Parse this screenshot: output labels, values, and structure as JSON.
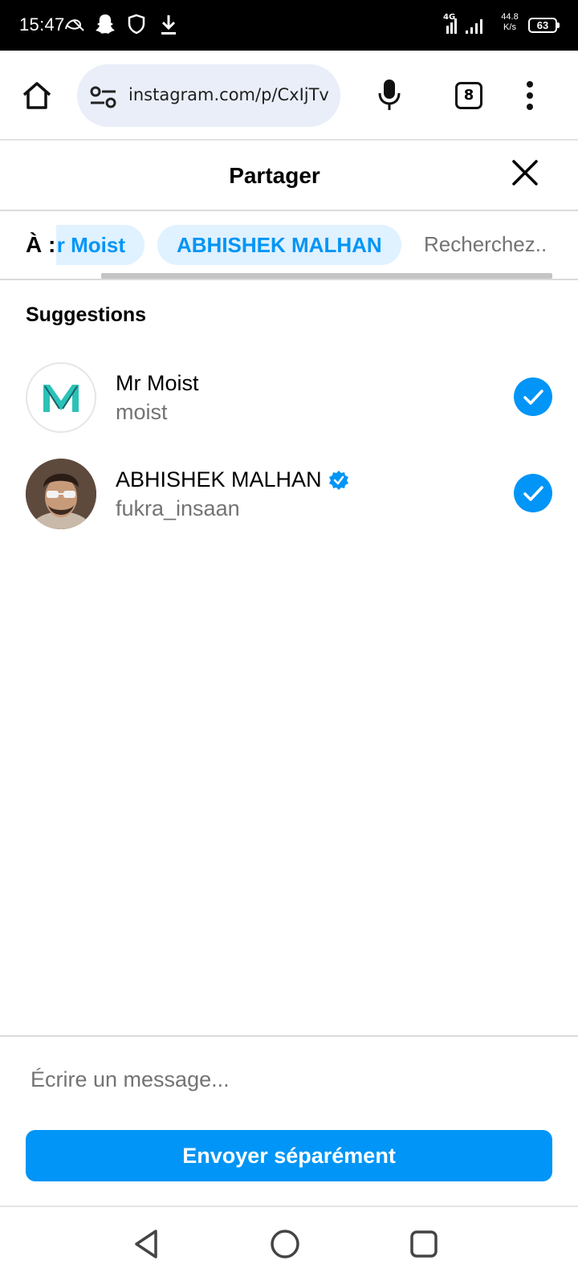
{
  "status_bar": {
    "time": "15:47",
    "icons": [
      "alarm-icon",
      "snapchat-icon",
      "shield-icon",
      "download-icon"
    ],
    "network": "4G",
    "speed_value": "44.8",
    "speed_unit": "K/s",
    "battery": "63"
  },
  "browser": {
    "url": "instagram.com/p/CxIjTv",
    "tab_count": "8"
  },
  "share": {
    "title": "Partager",
    "to_label": "À :",
    "selected_recipients": [
      "r Moist",
      "ABHISHEK MALHAN"
    ],
    "search_placeholder": "Recherchez..",
    "suggestions_heading": "Suggestions",
    "suggestions": [
      {
        "name": "Mr Moist",
        "username": "moist",
        "verified": false,
        "selected": true
      },
      {
        "name": "ABHISHEK MALHAN",
        "username": "fukra_insaan",
        "verified": true,
        "selected": true
      }
    ],
    "message_placeholder": "Écrire un message...",
    "send_label": "Envoyer séparément"
  },
  "colors": {
    "accent": "#0095f6",
    "chip_bg": "#e0f1ff",
    "url_pill_bg": "#e9eef8",
    "secondary_text": "#737373"
  }
}
